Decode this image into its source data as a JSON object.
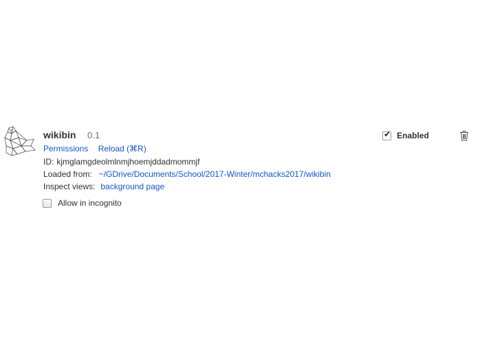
{
  "extension": {
    "name": "wikibin",
    "version": "0.1",
    "icon": "bird-polygon-logo",
    "links": {
      "permissions": "Permissions",
      "reload": "Reload (⌘R)"
    },
    "id_label": "ID:",
    "id_value": "kjmglamgdeolmlnmjhoemjddadmommjf",
    "loaded_from_label": "Loaded from:",
    "loaded_from_path": "~/GDrive/Documents/School/2017-Winter/mchacks2017/wikibin",
    "inspect_views_label": "Inspect views:",
    "inspect_views_link": "background page",
    "incognito_label": "Allow in incognito",
    "incognito_checked": false,
    "enabled_label": "Enabled",
    "enabled_checked": true,
    "remove_icon": "trash-icon"
  },
  "colors": {
    "link": "#1155cc",
    "text": "#303030",
    "version": "#6d6d6d"
  }
}
